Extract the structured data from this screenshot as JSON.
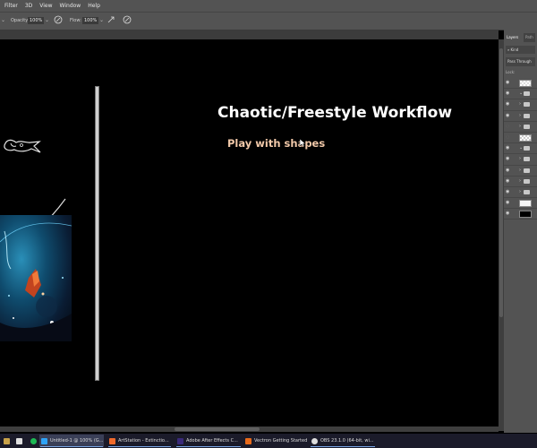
{
  "menu": [
    "Filter",
    "3D",
    "View",
    "Window",
    "Help"
  ],
  "options": {
    "opacity_label": "Opacity:",
    "opacity_value": "100%",
    "flow_label": "Flow:",
    "flow_value": "100%"
  },
  "canvas": {
    "title": "Chaotic/Freestyle Workflow",
    "subtitle": "Play with shapes"
  },
  "layers_panel": {
    "tab_layers": "Layers",
    "tab_paths": "Path",
    "search_placeholder": "Kind",
    "blend_mode": "Pass Through",
    "lock_label": "Lock:"
  },
  "taskbar": {
    "items": [
      "Untitled-1 @ 100% (G...",
      "ArtStation - Extinctio...",
      "Adobe After Effects C...",
      "Vectron Getting Started",
      "OBS 23.1.0 (64-bit, wi..."
    ]
  },
  "colors": {
    "ui_gray": "#535353",
    "title_text": "#ffffff",
    "subtitle_text": "#f2c9a9",
    "taskbar": "#1b1b2a"
  }
}
